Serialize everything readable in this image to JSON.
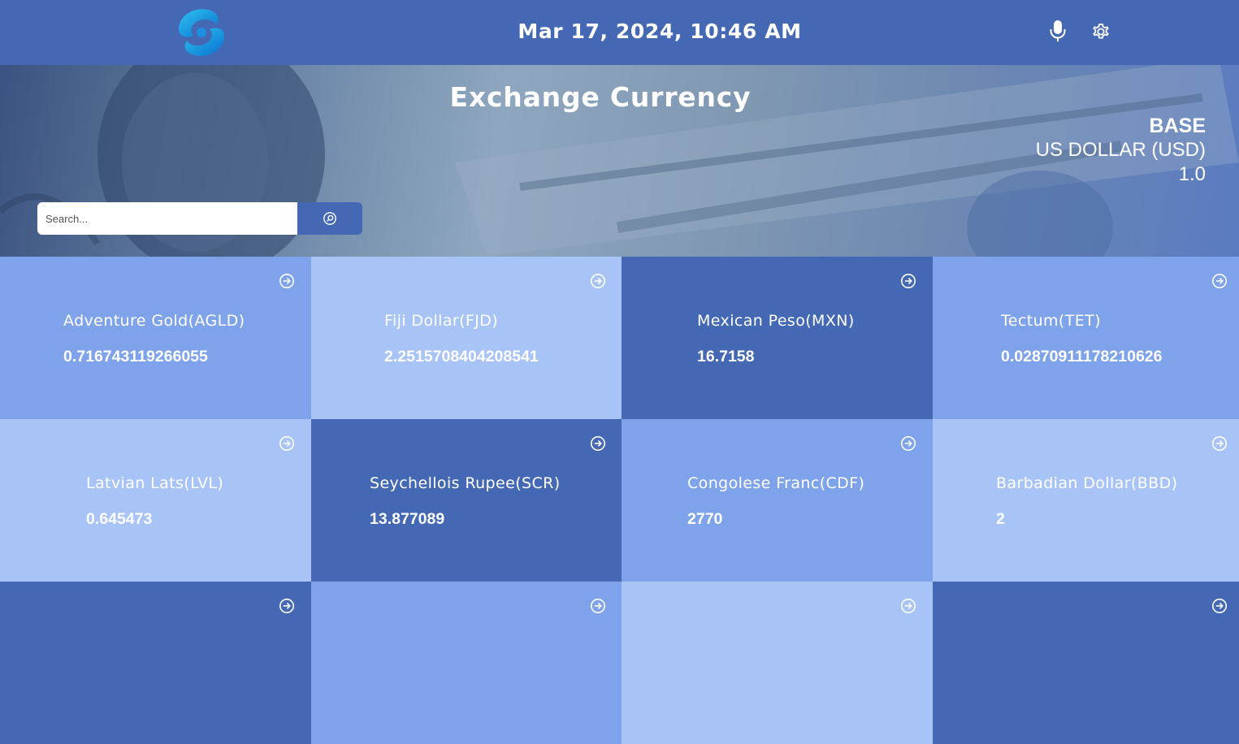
{
  "header": {
    "datetime": "Mar 17, 2024, 10:46 AM",
    "logo_icon": "syscoin-swirl-logo",
    "mic_icon": "microphone-icon",
    "settings_icon": "gear-icon"
  },
  "hero": {
    "title": "Exchange Currency",
    "base_label": "BASE",
    "base_currency": "US DOLLAR (USD)",
    "base_value": "1.0",
    "search_placeholder": "Search...",
    "search_icon": "search-icon"
  },
  "colors": {
    "dark": "#4468b4",
    "mid": "#7fa3ea",
    "light": "#a8c4f6"
  },
  "currencies": [
    {
      "name": "Adventure Gold(AGLD)",
      "value": "0.716743119266055",
      "tone": "mid"
    },
    {
      "name": "Fiji Dollar(FJD)",
      "value": "2.2515708404208541",
      "tone": "light"
    },
    {
      "name": "Mexican Peso(MXN)",
      "value": "16.7158",
      "tone": "dark"
    },
    {
      "name": "Tectum(TET)",
      "value": "0.02870911178210626",
      "tone": "mid"
    },
    {
      "name": "Latvian Lats(LVL)",
      "value": "0.645473",
      "tone": "light"
    },
    {
      "name": "Seychellois Rupee(SCR)",
      "value": "13.877089",
      "tone": "dark"
    },
    {
      "name": "Congolese Franc(CDF)",
      "value": "2770",
      "tone": "mid"
    },
    {
      "name": "Barbadian Dollar(BBD)",
      "value": "2",
      "tone": "light"
    },
    {
      "name": "",
      "value": "",
      "tone": "dark"
    },
    {
      "name": "",
      "value": "",
      "tone": "mid"
    },
    {
      "name": "",
      "value": "",
      "tone": "light"
    },
    {
      "name": "",
      "value": "",
      "tone": "dark"
    }
  ]
}
